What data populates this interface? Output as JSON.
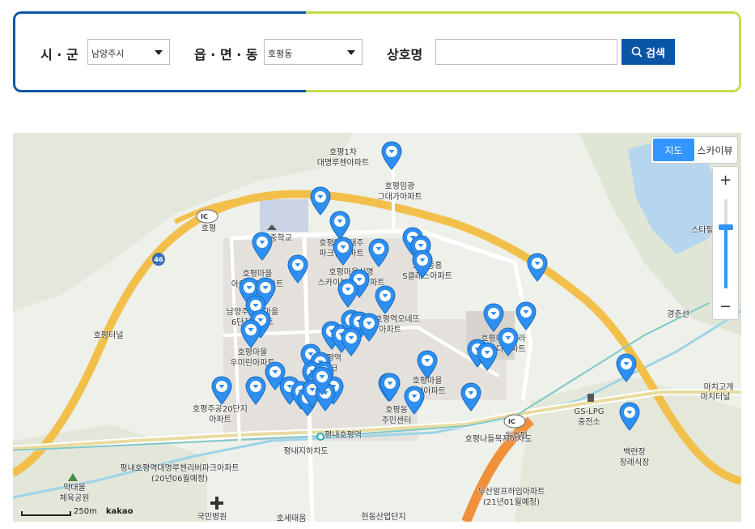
{
  "search": {
    "city_label": "시 · 군",
    "city_value": "남양주시",
    "town_label": "읍 · 면 · 동",
    "town_value": "호평동",
    "name_label": "상호명",
    "name_value": "",
    "button_label": "검색",
    "colors": {
      "left_border": "#0a56a4",
      "right_border": "#c6dc4a",
      "button": "#0a56a4"
    }
  },
  "map": {
    "type_buttons": {
      "map": "지도",
      "skyview": "스카이뷰",
      "active": "map"
    },
    "zoom": {
      "in": "+",
      "out": "−",
      "level": 0.7
    },
    "scale_text": "250m",
    "brand": "kakao",
    "ic_badges": [
      "IC",
      "IC"
    ],
    "labels": [
      {
        "id": "hopyeong1",
        "text": "호평1차\n대명루첸아파트"
      },
      {
        "id": "hopyeong-imgwang",
        "text": "호평임광\n그대가아파트"
      },
      {
        "id": "hopyeong-ic",
        "text": "호평"
      },
      {
        "id": "pangok-ms",
        "text": "판곡중학교"
      },
      {
        "id": "daeju",
        "text": "호평마을대주\n파크빌아파트"
      },
      {
        "id": "hopyeong-gyo",
        "text": "호평교"
      },
      {
        "id": "ipark",
        "text": "호평마을\n아이파크아파트"
      },
      {
        "id": "sinmyeong",
        "text": "호평마을신명\n스카이뷰하트아파트"
      },
      {
        "id": "jungheung",
        "text": "호평중흥\nS클래스아파트"
      },
      {
        "id": "namyang-6",
        "text": "남양주호평마을\n6단지아파트"
      },
      {
        "id": "pyeongnae-onet",
        "text": "평내호평역오네뜨\n아파트"
      },
      {
        "id": "bibaldi",
        "text": "호평마을한라\n비발디아파트"
      },
      {
        "id": "umirin",
        "text": "호평마을\n우미린아파트"
      },
      {
        "id": "pyeongnae-ipark",
        "text": "평내호평역\n아이파크"
      },
      {
        "id": "geumgang",
        "text": "호평마을\n금강아파트"
      },
      {
        "id": "mach-tunnel",
        "text": "마치고개"
      },
      {
        "id": "hopyeong-20",
        "text": "호평주공20단지\n아파트"
      },
      {
        "id": "jumin",
        "text": "호평동\n주민센터"
      },
      {
        "id": "gs-lpg",
        "text": "GS-LPG\n충전소"
      },
      {
        "id": "dongho",
        "text": "동호평"
      },
      {
        "id": "baekryeonjang",
        "text": "백련장\n장례식장"
      },
      {
        "id": "station",
        "text": "평내호평역"
      },
      {
        "id": "underpass",
        "text": "평내지하차도"
      },
      {
        "id": "daemyeong-river",
        "text": "평내호평역대명루첸리버파크아파트\n(20년06월예정)"
      },
      {
        "id": "yakdae",
        "text": "약대울\n체육공원"
      },
      {
        "id": "doosan",
        "text": "두산알프하임아파트\n(21년01월예정)"
      },
      {
        "id": "gukmin",
        "text": "국민병원"
      },
      {
        "id": "hyeondong",
        "text": "현동산업단지"
      },
      {
        "id": "hosetae",
        "text": "호세태움"
      },
      {
        "id": "gyeongchun",
        "text": "경춘선"
      },
      {
        "id": "starmall",
        "text": "스타필"
      },
      {
        "id": "route46",
        "text": "46"
      },
      {
        "id": "hopyeong-road",
        "text": "호평터널"
      },
      {
        "id": "machi-tunnel",
        "text": "마치터널"
      },
      {
        "id": "ic-hopyeong-road",
        "text": "호평나들목지하차도"
      }
    ],
    "marker_count": 52,
    "marker_color": "#2e8ff0"
  }
}
